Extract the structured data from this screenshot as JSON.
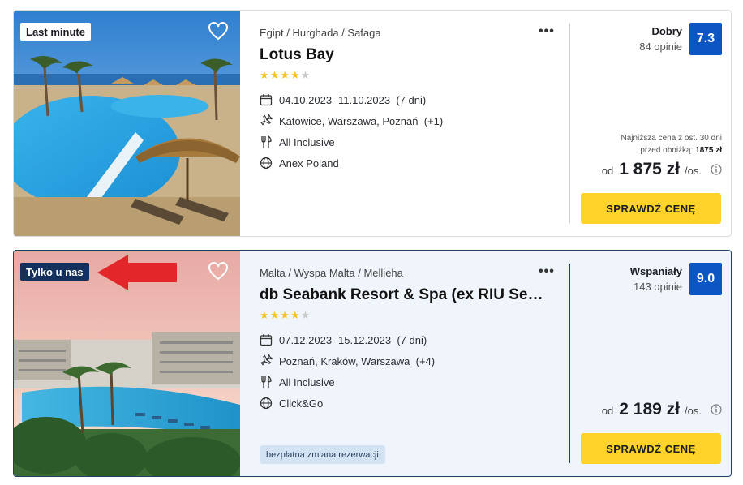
{
  "offers": [
    {
      "badge": "Last minute",
      "breadcrumb": "Egipt / Hurghada / Safaga",
      "title": "Lotus Bay",
      "stars": 4,
      "dates": "04.10.2023- 11.10.2023",
      "duration": "(7 dni)",
      "departures": "Katowice, Warszawa, Poznań",
      "departures_more": "(+1)",
      "board": "All Inclusive",
      "operator": "Anex Poland",
      "rating_word": "Dobry",
      "rating_count": "84 opinie",
      "score": "7.3",
      "lowest_line1": "Najniższa cena z ost. 30 dni",
      "lowest_line2": "przed obniżką:",
      "lowest_value": "1875 zł",
      "price_prefix": "od",
      "price": "1 875 zł",
      "price_unit": "/os.",
      "cta": "SPRAWDŹ CENĘ",
      "more": "•••"
    },
    {
      "badge": "Tylko u nas",
      "breadcrumb": "Malta / Wyspa Malta / Mellieha",
      "title": "db Seabank Resort & Spa (ex RIU Seabank Resort)",
      "stars": 4,
      "dates": "07.12.2023- 15.12.2023",
      "duration": "(7 dni)",
      "departures": "Poznań, Kraków, Warszawa",
      "departures_more": "(+4)",
      "board": "All Inclusive",
      "operator": "Click&Go",
      "tag": "bezpłatna zmiana rezerwacji",
      "rating_word": "Wspaniały",
      "rating_count": "143 opinie",
      "score": "9.0",
      "price_prefix": "od",
      "price": "2 189 zł",
      "price_unit": "/os.",
      "cta": "SPRAWDŹ CENĘ",
      "more": "•••"
    }
  ],
  "icons": {
    "calendar": "calendar-icon",
    "plane": "plane-icon",
    "board": "cutlery-icon",
    "operator": "globe-icon",
    "favorite": "heart-icon",
    "info": "info-icon"
  },
  "colors": {
    "score_bg": "#0e55c4",
    "cta_bg": "#ffd32a",
    "star": "#f6c21b",
    "badge_dark": "#13315c",
    "highlight_bg": "#eff5fb",
    "arrow": "#e3262a"
  }
}
